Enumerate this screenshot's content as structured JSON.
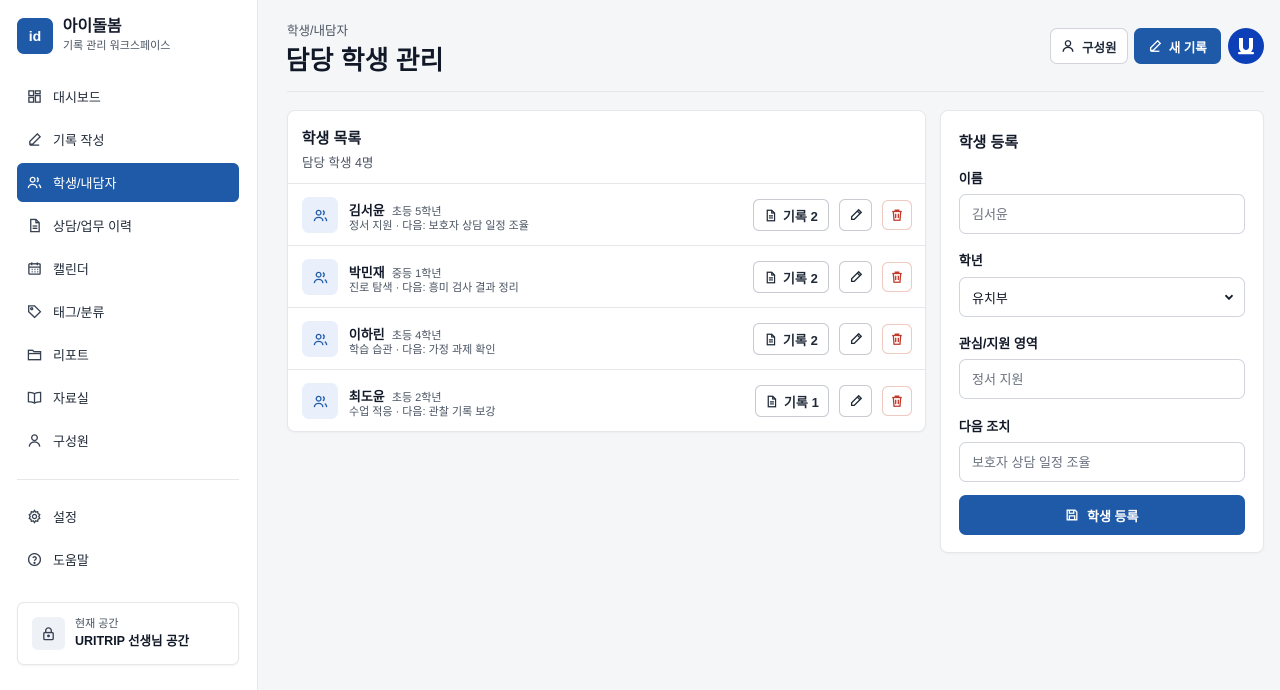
{
  "brand": {
    "logo": "id",
    "name": "아이돌봄",
    "subtitle": "기록 관리 워크스페이스"
  },
  "sidebar": {
    "items": [
      {
        "label": "대시보드",
        "icon": "dashboard-icon"
      },
      {
        "label": "기록 작성",
        "icon": "pencil-icon"
      },
      {
        "label": "학생/내담자",
        "icon": "users-icon",
        "active": true
      },
      {
        "label": "상담/업무 이력",
        "icon": "document-icon"
      },
      {
        "label": "캘린더",
        "icon": "calendar-icon"
      },
      {
        "label": "태그/분류",
        "icon": "tag-icon"
      },
      {
        "label": "리포트",
        "icon": "folder-icon"
      },
      {
        "label": "자료실",
        "icon": "book-icon"
      },
      {
        "label": "구성원",
        "icon": "user-icon"
      }
    ],
    "bottom_items": [
      {
        "label": "설정",
        "icon": "gear-icon"
      },
      {
        "label": "도움말",
        "icon": "help-icon"
      }
    ],
    "space": {
      "label": "현재 공간",
      "name": "URITRIP 선생님 공간"
    }
  },
  "header": {
    "breadcrumb": "학생/내담자",
    "title": "담당 학생 관리",
    "members_button": "구성원",
    "new_record_button": "새 기록"
  },
  "list": {
    "title": "학생 목록",
    "subtitle": "담당 학생 4명",
    "rows": [
      {
        "name": "김서윤",
        "grade": "초등 5학년",
        "meta": "정서 지원 · 다음: 보호자 상담 일정 조율",
        "records": "기록 2"
      },
      {
        "name": "박민재",
        "grade": "중등 1학년",
        "meta": "진로 탐색 · 다음: 흥미 검사 결과 정리",
        "records": "기록 2"
      },
      {
        "name": "이하린",
        "grade": "초등 4학년",
        "meta": "학습 습관 · 다음: 가정 과제 확인",
        "records": "기록 2"
      },
      {
        "name": "최도윤",
        "grade": "초등 2학년",
        "meta": "수업 적응 · 다음: 관찰 기록 보강",
        "records": "기록 1"
      }
    ]
  },
  "form": {
    "title": "학생 등록",
    "name_label": "이름",
    "name_placeholder": "김서윤",
    "grade_label": "학년",
    "grade_value": "유치부",
    "area_label": "관심/지원 영역",
    "area_placeholder": "정서 지원",
    "next_label": "다음 조치",
    "next_placeholder": "보호자 상담 일정 조율",
    "submit": "학생 등록"
  },
  "colors": {
    "primary": "#1e5aa8",
    "avatar": "#0d3fb8",
    "danger": "#c0392b"
  }
}
